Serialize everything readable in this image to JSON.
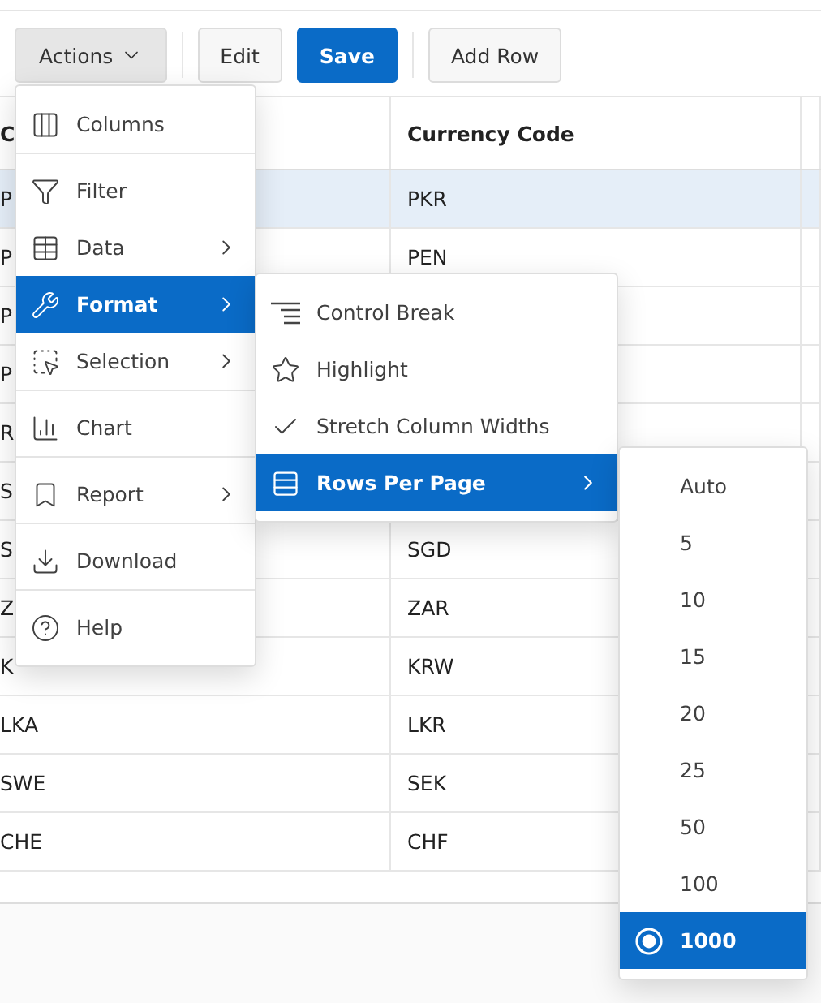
{
  "toolbar": {
    "buttons": [
      {
        "label": "Actions",
        "kind": "menu",
        "expanded": true
      },
      {
        "label": "Edit",
        "kind": "default"
      },
      {
        "label": "Save",
        "kind": "primary"
      },
      {
        "label": "Add Row",
        "kind": "default"
      }
    ]
  },
  "table": {
    "columns": [
      "C",
      "Currency Code"
    ],
    "rows": [
      {
        "cells": [
          "P",
          "PKR"
        ],
        "selected": true
      },
      {
        "cells": [
          "P",
          "PEN"
        ],
        "selected": false
      },
      {
        "cells": [
          "P",
          ""
        ],
        "selected": false
      },
      {
        "cells": [
          "P",
          ""
        ],
        "selected": false
      },
      {
        "cells": [
          "R",
          ""
        ],
        "selected": false
      },
      {
        "cells": [
          "S",
          ""
        ],
        "selected": false
      },
      {
        "cells": [
          "S",
          "SGD"
        ],
        "selected": false
      },
      {
        "cells": [
          "Z",
          "ZAR"
        ],
        "selected": false
      },
      {
        "cells": [
          "K",
          "KRW"
        ],
        "selected": false
      },
      {
        "cells": [
          "LKA",
          "LKR"
        ],
        "selected": false
      },
      {
        "cells": [
          "SWE",
          "SEK"
        ],
        "selected": false
      },
      {
        "cells": [
          "CHE",
          "CHF"
        ],
        "selected": false
      }
    ]
  },
  "actions_menu": {
    "items": [
      {
        "label": "Columns",
        "submenu": false,
        "selected": false,
        "separator_after": true
      },
      {
        "label": "Filter",
        "submenu": false,
        "selected": false,
        "separator_after": false
      },
      {
        "label": "Data",
        "submenu": true,
        "selected": false,
        "separator_after": false
      },
      {
        "label": "Format",
        "submenu": true,
        "selected": true,
        "separator_after": false
      },
      {
        "label": "Selection",
        "submenu": true,
        "selected": false,
        "separator_after": true
      },
      {
        "label": "Chart",
        "submenu": false,
        "selected": false,
        "separator_after": true
      },
      {
        "label": "Report",
        "submenu": true,
        "selected": false,
        "separator_after": true
      },
      {
        "label": "Download",
        "submenu": false,
        "selected": false,
        "separator_after": true
      },
      {
        "label": "Help",
        "submenu": false,
        "selected": false,
        "separator_after": false
      }
    ]
  },
  "format_menu": {
    "items": [
      {
        "label": "Control Break",
        "kind": "action",
        "submenu": false,
        "selected": false
      },
      {
        "label": "Highlight",
        "kind": "action",
        "submenu": false,
        "selected": false
      },
      {
        "label": "Stretch Column Widths",
        "kind": "toggle",
        "checked": true,
        "submenu": false,
        "selected": false
      },
      {
        "label": "Rows Per Page",
        "kind": "action",
        "submenu": true,
        "selected": true
      }
    ]
  },
  "rows_per_page_menu": {
    "options": [
      {
        "label": "Auto",
        "selected": false
      },
      {
        "label": "5",
        "selected": false
      },
      {
        "label": "10",
        "selected": false
      },
      {
        "label": "15",
        "selected": false
      },
      {
        "label": "20",
        "selected": false
      },
      {
        "label": "25",
        "selected": false
      },
      {
        "label": "50",
        "selected": false
      },
      {
        "label": "100",
        "selected": false
      },
      {
        "label": "1000",
        "selected": true
      }
    ]
  }
}
